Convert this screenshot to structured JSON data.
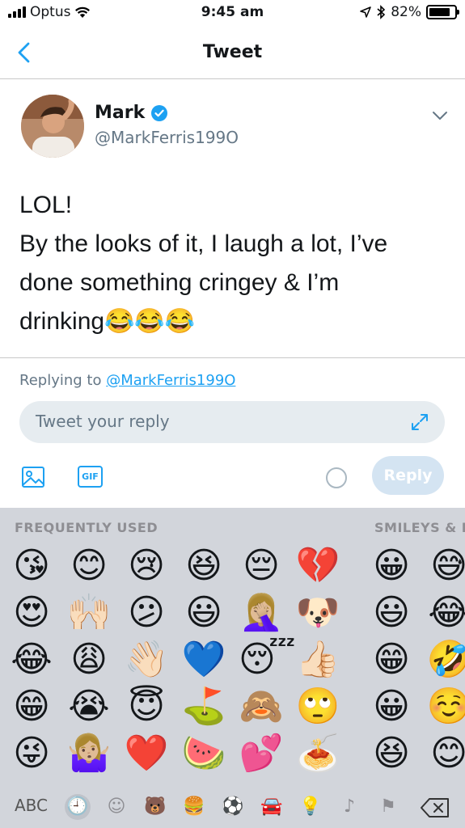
{
  "status_bar": {
    "carrier": "Optus",
    "time": "9:45 am",
    "battery": "82%",
    "battery_fraction": 0.82
  },
  "nav": {
    "title": "Tweet",
    "back_icon": "chevron-left-icon"
  },
  "tweet": {
    "author_name": "Mark",
    "verified": true,
    "handle": "@MarkFerris199O",
    "lines": [
      "LOL!",
      "By the looks of it, I laugh a lot, I’ve",
      "done something cringey & I’m",
      "drinking😂😂😂"
    ]
  },
  "reply": {
    "replying_prefix": "Replying to",
    "replying_handle": "@MarkFerris199O",
    "placeholder": "Tweet your reply",
    "gif_label": "GIF",
    "reply_button": "Reply"
  },
  "keyboard": {
    "section_frequent": "FREQUENTLY USED",
    "section_smileys": "SMILEYS & P",
    "emoji_rows": [
      [
        "😘",
        "😊",
        "😢",
        "😆",
        "😔",
        "💔",
        "😀",
        "😅"
      ],
      [
        "😍",
        "🙌🏻",
        "😕",
        "😃",
        "🤦🏼‍♀️",
        "🐶",
        "😃",
        "😂"
      ],
      [
        "😂",
        "😩",
        "👋🏻",
        "💙",
        "😴",
        "👍🏻",
        "😁",
        "🤣"
      ],
      [
        "😁",
        "😭",
        "😇",
        "⛳",
        "🙈",
        "🙄",
        "😀",
        "☺️"
      ],
      [
        "😜",
        "🤷🏼‍♀️",
        "❤️",
        "🍉",
        "💕",
        "🍝",
        "😆",
        "😊"
      ]
    ],
    "abc_key": "ABC",
    "categories": [
      "🕘",
      "☺",
      "🐻",
      "🍔",
      "⚽",
      "🚘",
      "💡",
      "♪",
      "⚑"
    ],
    "active_category": 0
  }
}
